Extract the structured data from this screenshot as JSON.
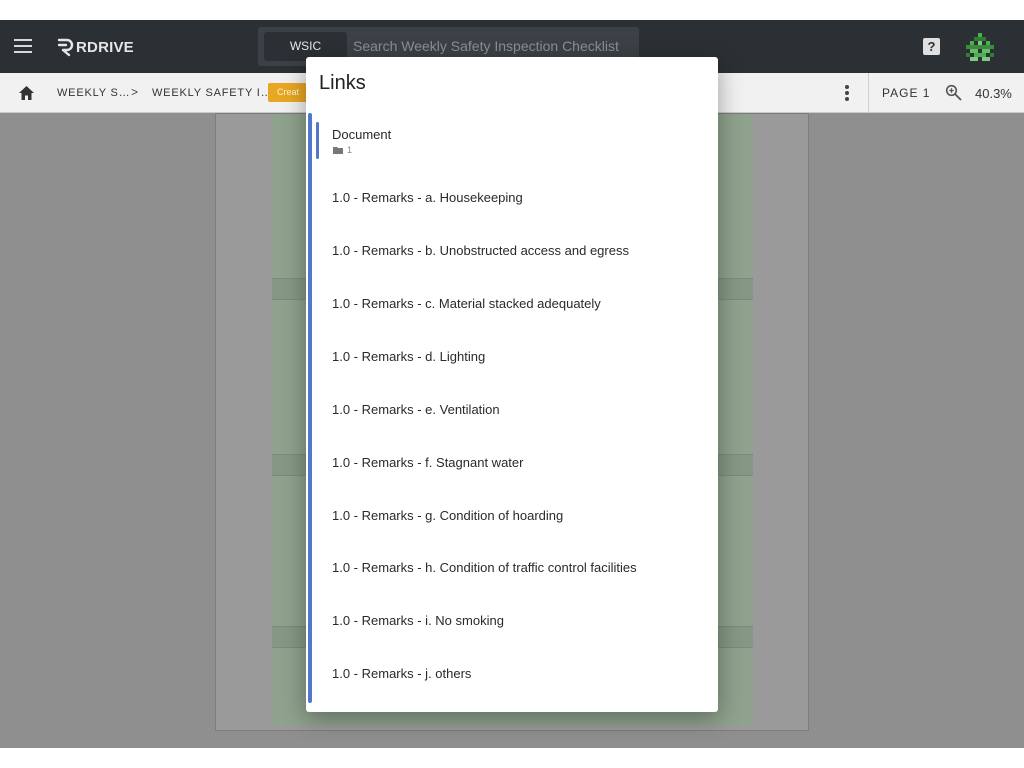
{
  "app": {
    "logo_text": "RDRIVE",
    "search_chip": "WSIC",
    "search_placeholder": "Search Weekly Safety Inspection Checklist",
    "help_glyph": "?"
  },
  "breadcrumb": {
    "items": [
      "WEEKLY S…",
      "WEEKLY SAFETY I…"
    ],
    "separator": ">",
    "status_badge": "Creat"
  },
  "viewer": {
    "page_label": "PAGE 1",
    "zoom": "40.3%"
  },
  "dialog": {
    "title": "Links",
    "document_label": "Document",
    "document_count": "1",
    "links": [
      "1.0 - Remarks - a. Housekeeping",
      "1.0 - Remarks - b. Unobstructed access and egress",
      "1.0 - Remarks - c. Material stacked adequately",
      "1.0 - Remarks - d. Lighting",
      "1.0 - Remarks - e. Ventilation",
      "1.0 - Remarks - f. Stagnant water",
      "1.0 - Remarks - g. Condition of hoarding",
      "1.0 - Remarks - h. Condition of traffic control facilities",
      "1.0 - Remarks - i. No smoking",
      "1.0 - Remarks - j. others"
    ]
  },
  "colors": {
    "topbar": "#2b3034",
    "accent": "#5278c9",
    "badge": "#e8a722",
    "avatar": "#4caf50"
  }
}
